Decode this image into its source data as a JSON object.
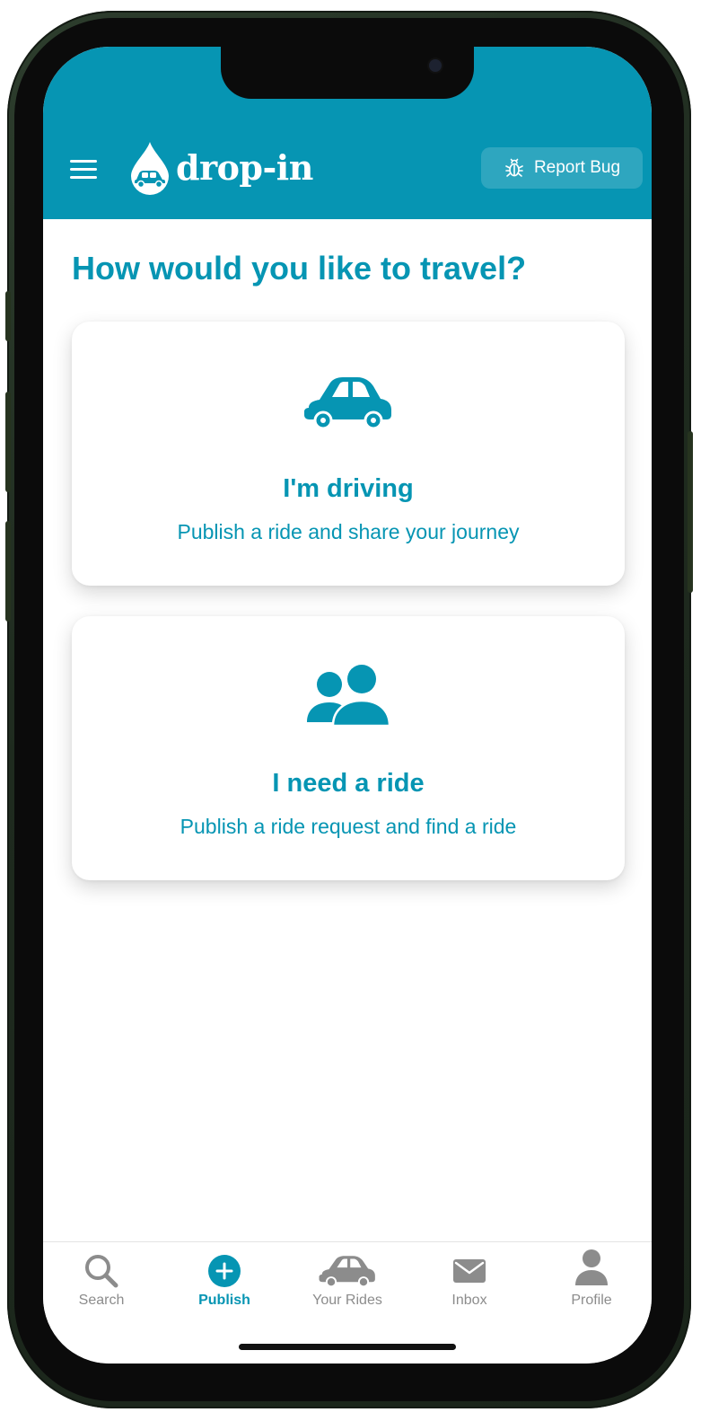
{
  "header": {
    "logo_text": "drop-in",
    "report_bug_label": "Report Bug"
  },
  "main": {
    "title": "How would you like to travel?",
    "options": [
      {
        "title": "I'm driving",
        "subtitle": "Publish a ride and share your journey",
        "icon": "car-icon"
      },
      {
        "title": "I need a ride",
        "subtitle": "Publish a ride request and find a ride",
        "icon": "users-icon"
      }
    ]
  },
  "tabbar": {
    "items": [
      {
        "label": "Search",
        "icon": "search-icon",
        "active": false
      },
      {
        "label": "Publish",
        "icon": "plus-circle-icon",
        "active": true
      },
      {
        "label": "Your Rides",
        "icon": "car-icon",
        "active": false
      },
      {
        "label": "Inbox",
        "icon": "envelope-icon",
        "active": false
      },
      {
        "label": "Profile",
        "icon": "user-icon",
        "active": false
      }
    ]
  },
  "colors": {
    "brand": "#0695b3",
    "inactive": "#8c8c8c",
    "background": "#ffffff"
  }
}
